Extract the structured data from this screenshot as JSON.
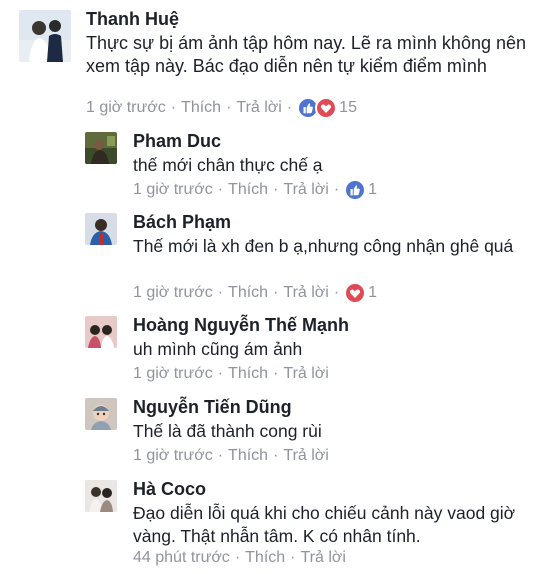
{
  "labels": {
    "like": "Thích",
    "reply": "Trả lời",
    "dot": "·"
  },
  "comments": [
    {
      "author": "Thanh Huệ",
      "text": "Thực sự bị ám ảnh tập hôm nay. Lẽ ra mình không nên xem tập này. Bác đạo diễn nên tự kiểm điểm mình",
      "time": "1 giờ trước",
      "reactions": [
        "like-icon",
        "love-icon"
      ],
      "reaction_count": "15"
    },
    {
      "author": "Pham Duc",
      "text": "thế mới chân thực chế ạ",
      "time": "1 giờ trước",
      "reactions": [
        "like-icon"
      ],
      "reaction_count": "1"
    },
    {
      "author": "Bách Phạm",
      "text": "Thế mới là xh đen b ạ,nhưng công nhận ghê quá",
      "time": "1 giờ trước",
      "reactions": [
        "love-icon"
      ],
      "reaction_count": "1"
    },
    {
      "author": "Hoàng Nguyễn Thế Mạnh",
      "text": "uh mình cũng ám ảnh",
      "time": "1 giờ trước"
    },
    {
      "author": "Nguyễn Tiến Dũng",
      "text": "Thế là đã thành cong rùi",
      "time": "1 giờ trước"
    },
    {
      "author": "Hà Coco",
      "text": "Đạo diễn lỗi quá khi cho chiếu cảnh này vaod giờ vàng. Thật nhẫn tâm. K có nhân tính.",
      "time": "44 phút trước"
    }
  ],
  "colors": {
    "like": "#4f73ce",
    "love": "#e14955",
    "meta": "#90949c",
    "text": "#1d2129"
  }
}
